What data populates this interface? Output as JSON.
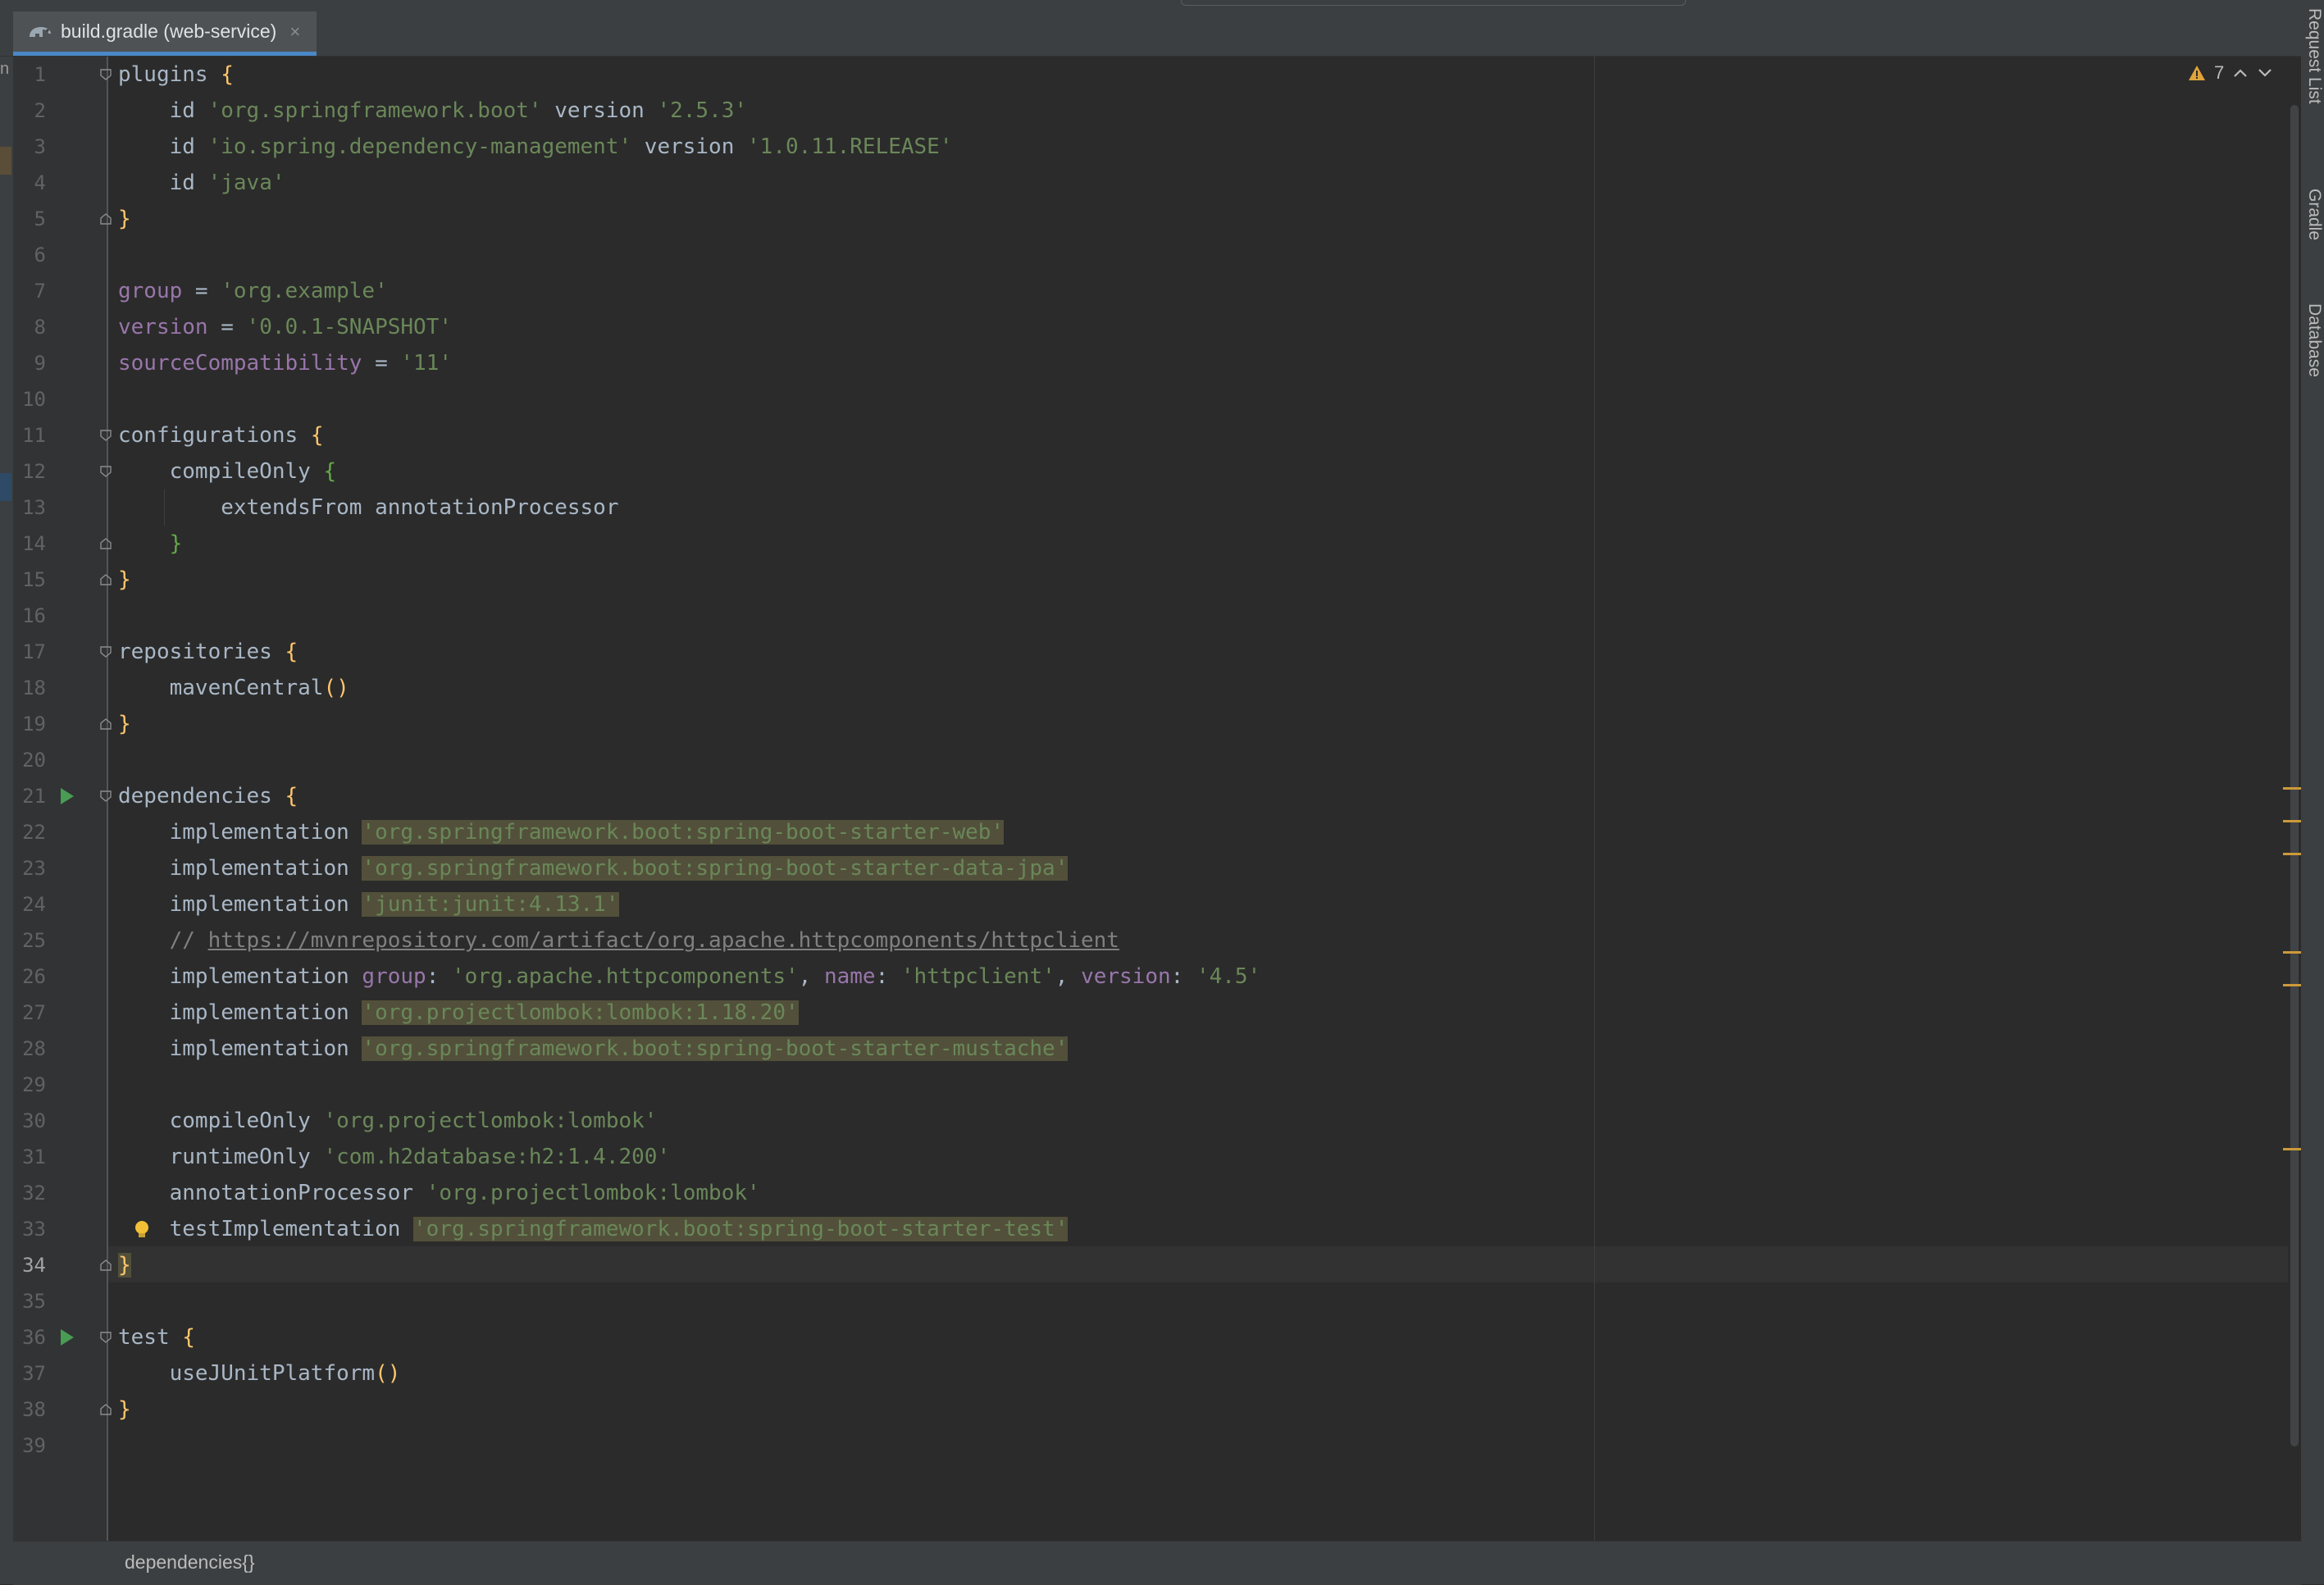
{
  "tab": {
    "title": "build.gradle (web-service)",
    "close": "×",
    "icon": "gradle-elephant-icon"
  },
  "left_strip": {
    "letter": "n"
  },
  "inspection": {
    "warning_count": "7",
    "icons": [
      "warning-icon",
      "chevron-up-icon",
      "chevron-down-icon"
    ]
  },
  "right_tools": [
    "Request List",
    "Gradle",
    "Database"
  ],
  "breadcrumb": "dependencies{}",
  "lines": [
    {
      "n": "1",
      "parts": [
        [
          "kw",
          "plugins "
        ],
        [
          "brace-y",
          "{"
        ]
      ]
    },
    {
      "n": "2",
      "parts": [
        [
          "kw",
          "    id "
        ],
        [
          "str",
          "'org.springframework.boot'"
        ],
        [
          "kw",
          " version "
        ],
        [
          "str",
          "'2.5.3'"
        ]
      ]
    },
    {
      "n": "3",
      "parts": [
        [
          "kw",
          "    id "
        ],
        [
          "str",
          "'io.spring.dependency-management'"
        ],
        [
          "kw",
          " version "
        ],
        [
          "str",
          "'1.0.11.RELEASE'"
        ]
      ]
    },
    {
      "n": "4",
      "parts": [
        [
          "kw",
          "    id "
        ],
        [
          "str",
          "'java'"
        ]
      ]
    },
    {
      "n": "5",
      "parts": [
        [
          "brace-y",
          "}"
        ]
      ]
    },
    {
      "n": "6",
      "parts": []
    },
    {
      "n": "7",
      "parts": [
        [
          "prop",
          "group"
        ],
        [
          "kw",
          " = "
        ],
        [
          "str",
          "'org.example'"
        ]
      ]
    },
    {
      "n": "8",
      "parts": [
        [
          "prop",
          "version"
        ],
        [
          "kw",
          " = "
        ],
        [
          "str",
          "'0.0.1-SNAPSHOT'"
        ]
      ]
    },
    {
      "n": "9",
      "parts": [
        [
          "prop",
          "sourceCompatibility"
        ],
        [
          "kw",
          " = "
        ],
        [
          "str",
          "'11'"
        ]
      ]
    },
    {
      "n": "10",
      "parts": []
    },
    {
      "n": "11",
      "parts": [
        [
          "kw",
          "configurations "
        ],
        [
          "brace-y",
          "{"
        ]
      ]
    },
    {
      "n": "12",
      "parts": [
        [
          "kw",
          "    compileOnly "
        ],
        [
          "brace-g",
          "{"
        ]
      ]
    },
    {
      "n": "13",
      "parts": [
        [
          "kw",
          "        extendsFrom annotationProcessor"
        ]
      ]
    },
    {
      "n": "14",
      "parts": [
        [
          "kw",
          "    "
        ],
        [
          "brace-g",
          "}"
        ]
      ]
    },
    {
      "n": "15",
      "parts": [
        [
          "brace-y",
          "}"
        ]
      ]
    },
    {
      "n": "16",
      "parts": []
    },
    {
      "n": "17",
      "parts": [
        [
          "kw",
          "repositories "
        ],
        [
          "brace-y",
          "{"
        ]
      ]
    },
    {
      "n": "18",
      "parts": [
        [
          "kw",
          "    mavenCentral"
        ],
        [
          "brace-y",
          "()"
        ]
      ]
    },
    {
      "n": "19",
      "parts": [
        [
          "brace-y",
          "}"
        ]
      ]
    },
    {
      "n": "20",
      "parts": []
    },
    {
      "n": "21",
      "parts": [
        [
          "kw",
          "dependencies "
        ],
        [
          "brace-y",
          "{"
        ]
      ]
    },
    {
      "n": "22",
      "parts": [
        [
          "kw",
          "    implementation "
        ],
        [
          "str hl",
          "'org.springframework.boot:spring-boot-starter-web'"
        ]
      ]
    },
    {
      "n": "23",
      "parts": [
        [
          "kw",
          "    implementation "
        ],
        [
          "str hl",
          "'org.springframework.boot:spring-boot-starter-data-jpa'"
        ]
      ]
    },
    {
      "n": "24",
      "parts": [
        [
          "kw",
          "    implementation "
        ],
        [
          "str hl",
          "'junit:junit:4.13.1'"
        ]
      ]
    },
    {
      "n": "25",
      "parts": [
        [
          "cmt",
          "    // "
        ],
        [
          "url",
          "https://mvnrepository.com/artifact/org.apache.httpcomponents/httpclient"
        ]
      ]
    },
    {
      "n": "26",
      "parts": [
        [
          "kw",
          "    implementation "
        ],
        [
          "namedarg",
          "group"
        ],
        [
          "kw",
          ": "
        ],
        [
          "str",
          "'org.apache.httpcomponents'"
        ],
        [
          "kw",
          ", "
        ],
        [
          "namedarg",
          "name"
        ],
        [
          "kw",
          ": "
        ],
        [
          "str",
          "'httpclient'"
        ],
        [
          "kw",
          ", "
        ],
        [
          "namedarg",
          "version"
        ],
        [
          "kw",
          ": "
        ],
        [
          "str",
          "'4.5'"
        ]
      ]
    },
    {
      "n": "27",
      "parts": [
        [
          "kw",
          "    implementation "
        ],
        [
          "str hl",
          "'org.projectlombok:lombok:1.18.20'"
        ]
      ]
    },
    {
      "n": "28",
      "parts": [
        [
          "kw",
          "    implementation "
        ],
        [
          "str hl",
          "'org.springframework.boot:spring-boot-starter-mustache'"
        ]
      ]
    },
    {
      "n": "29",
      "parts": []
    },
    {
      "n": "30",
      "parts": [
        [
          "kw",
          "    compileOnly "
        ],
        [
          "str",
          "'org.projectlombok:lombok'"
        ]
      ]
    },
    {
      "n": "31",
      "parts": [
        [
          "kw",
          "    runtimeOnly "
        ],
        [
          "str",
          "'com.h2database:h2:1.4.200'"
        ]
      ]
    },
    {
      "n": "32",
      "parts": [
        [
          "kw",
          "    annotationProcessor "
        ],
        [
          "str",
          "'org.projectlombok:lombok'"
        ]
      ]
    },
    {
      "n": "33",
      "parts": [
        [
          "kw",
          "    testImplementation "
        ],
        [
          "str hl",
          "'org.springframework.boot:spring-boot-starter-test'"
        ]
      ]
    },
    {
      "n": "34",
      "parts": [
        [
          "brace-y hl",
          "}"
        ]
      ]
    },
    {
      "n": "35",
      "parts": []
    },
    {
      "n": "36",
      "parts": [
        [
          "kw",
          "test "
        ],
        [
          "brace-y",
          "{"
        ]
      ]
    },
    {
      "n": "37",
      "parts": [
        [
          "kw",
          "    useJUnitPlatform"
        ],
        [
          "brace-y",
          "()"
        ]
      ]
    },
    {
      "n": "38",
      "parts": [
        [
          "brace-y",
          "}"
        ]
      ]
    },
    {
      "n": "39",
      "parts": []
    }
  ]
}
